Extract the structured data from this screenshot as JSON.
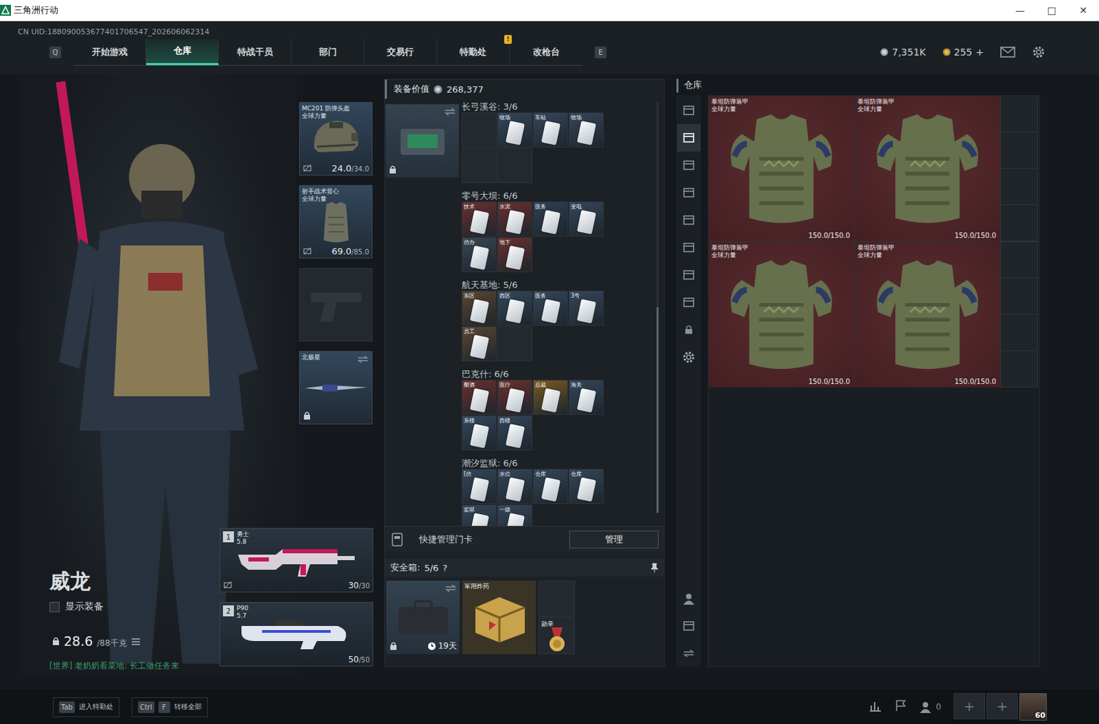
{
  "window": {
    "title": "三角洲行动",
    "controls": [
      {
        "symbol": "—"
      },
      {
        "symbol": "□"
      },
      {
        "symbol": "✕"
      }
    ]
  },
  "uid": "CN UID:188090053677401706547_202606062314",
  "nav": {
    "prev_key": "Q",
    "next_key": "E",
    "tabs": [
      {
        "label": "开始游戏",
        "selected": false
      },
      {
        "label": "仓库",
        "selected": true
      },
      {
        "label": "特战干员",
        "selected": false
      },
      {
        "label": "部门",
        "selected": false
      },
      {
        "label": "交易行",
        "selected": false
      },
      {
        "label": "特勤处",
        "selected": false,
        "badge": "!"
      },
      {
        "label": "改枪台",
        "selected": false
      }
    ],
    "currencies": [
      {
        "amount": "7,351K",
        "kind": "silver"
      },
      {
        "amount": "255",
        "kind": "gold"
      }
    ],
    "top_up": "+"
  },
  "operator": {
    "name": "威龙",
    "show_equipment": {
      "label": "显示装备",
      "checked": false
    },
    "weight": "28.6",
    "weight_max": "/88千克",
    "chat": "[世界] 老奶奶看菜地: 长工做任务来"
  },
  "gear_slots": [
    {
      "kind": "helmet",
      "name": "MC201 防弹头盔",
      "brand": "全球力量",
      "durability": "24.0",
      "durability_max": "/34.0"
    },
    {
      "kind": "armor",
      "name": "射手战术背心",
      "brand": "全球力量",
      "durability": "69.0",
      "durability_max": "/85.0"
    },
    {
      "kind": "pistol"
    },
    {
      "kind": "melee",
      "name": "北极星"
    }
  ],
  "weapons": [
    {
      "index": "1",
      "name": "勇士",
      "caliber": "5.8",
      "ammo": "30",
      "ammo_max": "/30"
    },
    {
      "index": "2",
      "name": "P90",
      "caliber": "5.7",
      "ammo": "50",
      "ammo_max": "/50"
    }
  ],
  "loadout": {
    "title": "装备价值",
    "value": "268,377",
    "keycard_sections": [
      {
        "title": "长弓溪谷: 3/6",
        "cards": [
          {
            "filled": false
          },
          {
            "filled": true,
            "label": "牧场",
            "color": "#34475c"
          },
          {
            "filled": true,
            "label": "车站",
            "color": "#34475c"
          },
          {
            "filled": true,
            "label": "牧场",
            "color": "#34475c"
          },
          {
            "filled": false
          },
          {
            "filled": false
          }
        ]
      },
      {
        "title": "零号大坝: 6/6",
        "cards": [
          {
            "filled": true,
            "label": "技术",
            "color": "#6b2f2f"
          },
          {
            "filled": true,
            "label": "水泥",
            "color": "#6b2f2f"
          },
          {
            "filled": true,
            "label": "医务",
            "color": "#2f3f55"
          },
          {
            "filled": true,
            "label": "变电",
            "color": "#34475c"
          },
          {
            "filled": true,
            "label": "仿办",
            "color": "#3a4654"
          },
          {
            "filled": true,
            "label": "地下",
            "color": "#6b2f2f"
          }
        ]
      },
      {
        "title": "航天基地: 5/6",
        "cards": [
          {
            "filled": true,
            "label": "东区",
            "color": "#5a4632"
          },
          {
            "filled": true,
            "label": "西区",
            "color": "#34475c"
          },
          {
            "filled": true,
            "label": "医务",
            "color": "#34475c"
          },
          {
            "filled": true,
            "label": "3号",
            "color": "#34475c"
          },
          {
            "filled": true,
            "label": "员工",
            "color": "#5a4632"
          },
          {
            "filled": false
          }
        ]
      },
      {
        "title": "巴克什: 6/6",
        "cards": [
          {
            "filled": true,
            "label": "酿酒",
            "color": "#6b2f2f"
          },
          {
            "filled": true,
            "label": "医疗",
            "color": "#6b2f2f"
          },
          {
            "filled": true,
            "label": "总裁",
            "color": "#7a5a22"
          },
          {
            "filled": true,
            "label": "海关",
            "color": "#34475c"
          },
          {
            "filled": true,
            "label": "东楼",
            "color": "#34475c"
          },
          {
            "filled": true,
            "label": "西楼",
            "color": "#34475c"
          }
        ]
      },
      {
        "title": "潮汐监狱: 6/6",
        "cards": [
          {
            "filled": true,
            "label": "[仿",
            "color": "#34475c"
          },
          {
            "filled": true,
            "label": "水位",
            "color": "#34475c"
          },
          {
            "filled": true,
            "label": "仓库",
            "color": "#34475c"
          },
          {
            "filled": true,
            "label": "仓库",
            "color": "#34475c"
          },
          {
            "filled": true,
            "label": "监狱",
            "color": "#34475c"
          },
          {
            "filled": true,
            "label": "一级",
            "color": "#34475c"
          }
        ]
      }
    ],
    "quick_manage": {
      "label": "快捷管理门卡",
      "button": "管理"
    },
    "safe_box": {
      "label": "安全箱:",
      "count": "5/6",
      "help": "?",
      "timer": "19天",
      "items": [
        {
          "name": "军用炸药",
          "kind": "crate"
        },
        {
          "name": "勋章",
          "kind": "medal"
        }
      ]
    }
  },
  "warehouse": {
    "title": "仓库",
    "tabs": [
      {
        "selected": false
      },
      {
        "selected": true
      },
      {
        "selected": false
      },
      {
        "selected": false
      },
      {
        "selected": false
      },
      {
        "selected": false
      },
      {
        "selected": false
      },
      {
        "selected": false
      }
    ],
    "items": [
      {
        "name": "泰坦防弹装甲",
        "brand": "全球力量",
        "durability": "150.0/150.0"
      },
      {
        "name": "泰坦防弹装甲",
        "brand": "全球力量",
        "durability": "150.0/150.0"
      },
      {
        "name": "泰坦防弹装甲",
        "brand": "全球力量",
        "durability": "150.0/150.0"
      },
      {
        "name": "泰坦防弹装甲",
        "brand": "全球力量",
        "durability": "150.0/150.0"
      }
    ]
  },
  "bottom_bar": {
    "hints": [
      {
        "keys": [
          "Tab"
        ],
        "label": "进入特勤处"
      },
      {
        "keys": [
          "Ctrl",
          "F"
        ],
        "label": "转移全部"
      }
    ],
    "friends": "0",
    "slots": [
      {
        "symbol": "+"
      },
      {
        "symbol": "+"
      }
    ],
    "level": "60"
  }
}
